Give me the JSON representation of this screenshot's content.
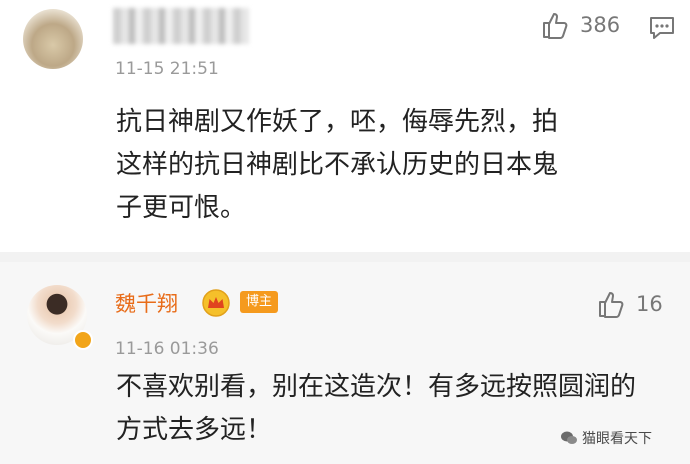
{
  "comments": [
    {
      "likes": "386",
      "time": "11-15 21:51",
      "text": "抗日神剧又作妖了，呸，侮辱先烈，拍这样的抗日神剧比不承认历史的日本鬼子更可恨。",
      "lines": [
        "抗日神剧又作妖了，呸，侮辱先烈，拍",
        "这样的抗日神剧比不承认历史的日本鬼",
        "子更可恨。"
      ]
    },
    {
      "name": "魏千翔",
      "badge": "博主",
      "likes": "16",
      "time": "11-16 01:36",
      "lines": [
        "不喜欢别看，别在这造次！有多远按照圆润的",
        "方式去多远！"
      ]
    }
  ],
  "watermark": "猫眼看天下",
  "icons": {
    "like": "thumbs-up-icon",
    "more": "chat-bubble-icon",
    "crown": "crown-icon"
  },
  "colors": {
    "name": "#e86c19",
    "badge": "#f59a1e",
    "meta": "#9a9a9a"
  }
}
